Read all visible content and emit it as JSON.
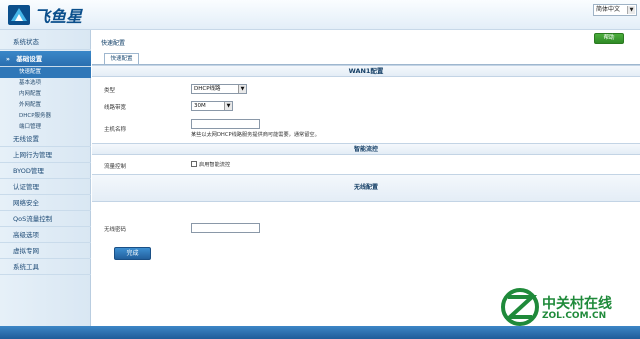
{
  "header": {
    "logo_text": "飞鱼星",
    "language_select": "简体中文"
  },
  "sidebar": {
    "items": [
      {
        "label": "系统状态"
      },
      {
        "label": "基础设置"
      },
      {
        "label": "无线设置"
      },
      {
        "label": "上网行为管理"
      },
      {
        "label": "BYOD管理"
      },
      {
        "label": "认证管理"
      },
      {
        "label": "网络安全"
      },
      {
        "label": "QoS流量控制"
      },
      {
        "label": "高级选项"
      },
      {
        "label": "虚拟专网"
      },
      {
        "label": "系统工具"
      }
    ],
    "sub_items": [
      {
        "label": "快速配置"
      },
      {
        "label": "基本选项"
      },
      {
        "label": "内网配置"
      },
      {
        "label": "外网配置"
      },
      {
        "label": "DHCP服务器"
      },
      {
        "label": "端口管理"
      }
    ]
  },
  "content": {
    "page_title": "快速配置",
    "help_button": "帮助",
    "tab_label": "快速配置",
    "wan_section": {
      "title": "WAN1配置",
      "type_label": "类型",
      "type_value": "DHCP线路",
      "bandwidth_label": "线路带宽",
      "bandwidth_value": "30M",
      "hostname_label": "主机名称",
      "hostname_value": "",
      "hostname_hint": "某些以太网DHCP线路服务提供商可能需要，通常留空。"
    },
    "smart_flow_section": {
      "title": "智能流控",
      "flow_label": "流量控制",
      "flow_checkbox_label": "启用智能流控"
    },
    "wireless_section": {
      "title": "无线配置",
      "password_label": "无线密码",
      "password_value": ""
    },
    "done_button": "完成"
  },
  "watermark": {
    "cn": "中关村在线",
    "en": "ZOL.COM.CN"
  },
  "colors": {
    "brand_blue": "#0b4f8c",
    "active_nav": "#2f77b8",
    "help_green": "#2f8a26",
    "watermark_green": "#1f8a3a"
  }
}
